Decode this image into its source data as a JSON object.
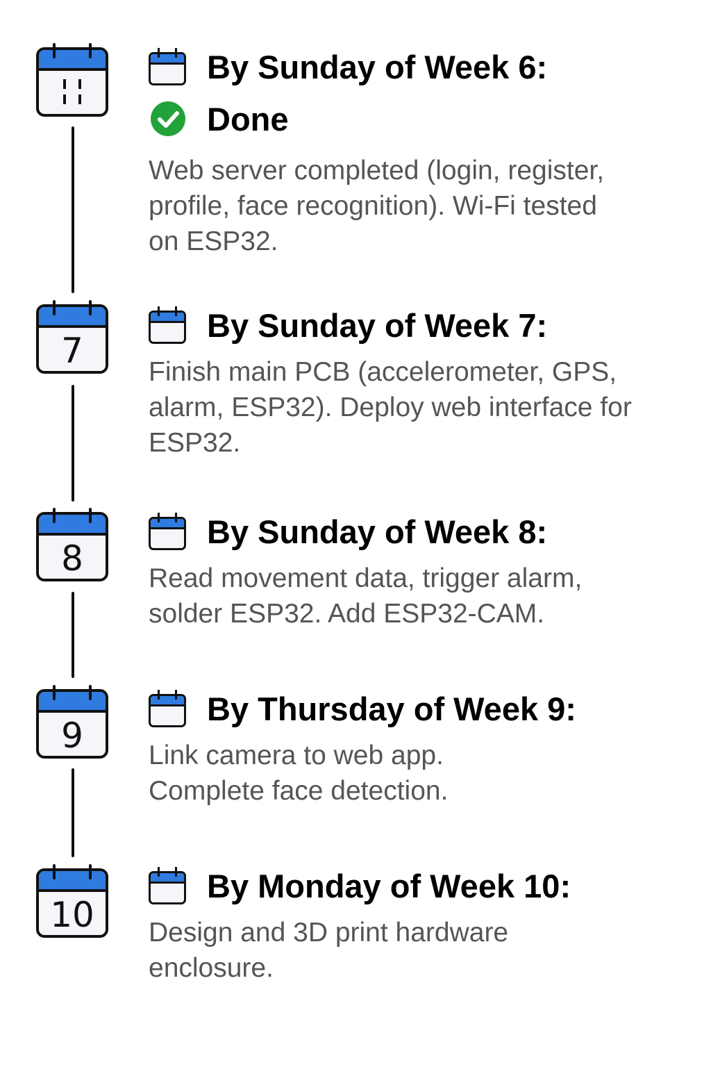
{
  "accent_color": "#2f7be0",
  "done_color": "#22a23a",
  "milestones": [
    {
      "calendar_label": "",
      "calendar_icon": "calendar-icon",
      "heading": "By Sunday of Week 6:",
      "status": "Done",
      "status_icon": "check-circle-icon",
      "description_lines": [
        "Web server completed (login, register,",
        "profile, face recognition). Wi-Fi tested",
        "on ESP32."
      ]
    },
    {
      "calendar_label": "7",
      "calendar_icon": "calendar-icon",
      "heading": "By Sunday of Week 7:",
      "description_lines": [
        "Finish main PCB (accelerometer, GPS,",
        "alarm, ESP32). Deploy web interface for",
        "ESP32."
      ]
    },
    {
      "calendar_label": "8",
      "calendar_icon": "calendar-icon",
      "heading": "By Sunday of Week 8:",
      "description_lines": [
        "Read movement data, trigger alarm,",
        "solder ESP32. Add ESP32-CAM."
      ]
    },
    {
      "calendar_label": "9",
      "calendar_icon": "calendar-icon",
      "heading": "By Thursday of Week 9:",
      "description_lines": [
        "Link camera to web app.",
        "Complete face detection."
      ]
    },
    {
      "calendar_label": "10",
      "calendar_icon": "calendar-icon",
      "heading": "By Monday of Week 10:",
      "description_lines": [
        "Design and 3D print hardware",
        "enclosure."
      ]
    }
  ]
}
